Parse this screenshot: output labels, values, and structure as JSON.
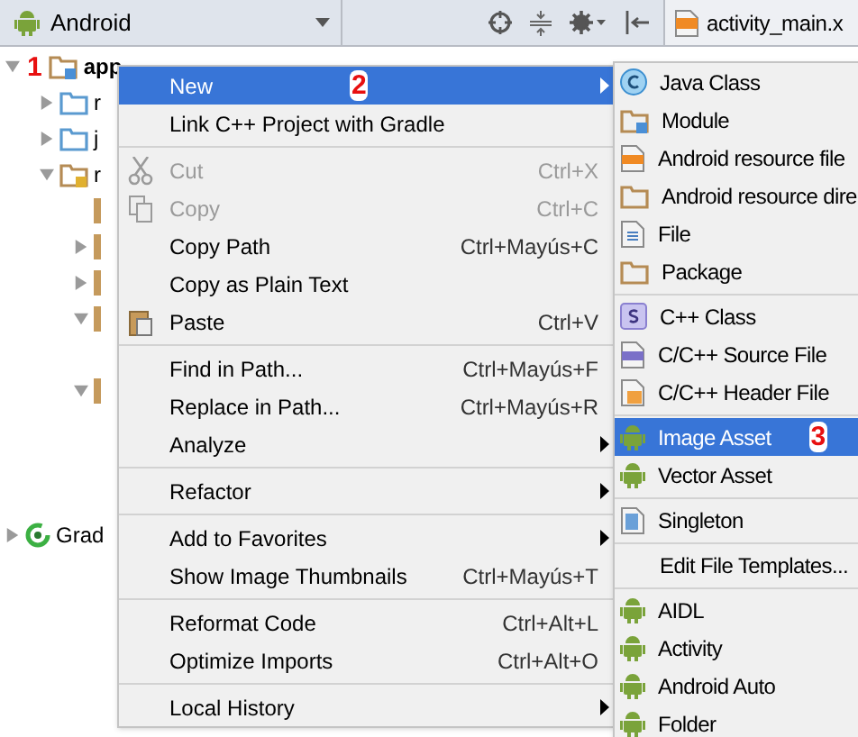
{
  "toolbar": {
    "view": "Android",
    "tab": "activity_main.x"
  },
  "tree": [
    {
      "label": "app",
      "expanded": true,
      "marker": "1",
      "children": [
        {
          "label": "r",
          "expanded": false
        },
        {
          "label": "j",
          "expanded": false
        },
        {
          "label": "r",
          "expanded": true,
          "children": [
            {
              "kind": "leaf"
            },
            {
              "kind": "node",
              "expanded": false
            },
            {
              "kind": "node",
              "expanded": false
            },
            {
              "kind": "node",
              "expanded": true
            },
            {
              "kind": "node",
              "expanded": true
            }
          ]
        }
      ]
    },
    {
      "label": "Grad",
      "expanded": false
    }
  ],
  "context_menu": [
    {
      "kind": "item",
      "label": "New",
      "submenu": true,
      "selected": true,
      "disabled": false,
      "marker": "2"
    },
    {
      "kind": "item",
      "label": "Link C++ Project with Gradle",
      "submenu": false,
      "selected": false,
      "disabled": false
    },
    {
      "kind": "separator"
    },
    {
      "kind": "item",
      "label": "Cut",
      "shortcut": "Ctrl+X",
      "submenu": false,
      "selected": false,
      "disabled": true
    },
    {
      "kind": "item",
      "label": "Copy",
      "shortcut": "Ctrl+C",
      "submenu": false,
      "selected": false,
      "disabled": true
    },
    {
      "kind": "item",
      "label": "Copy Path",
      "shortcut": "Ctrl+Mayús+C",
      "submenu": false,
      "selected": false,
      "disabled": false
    },
    {
      "kind": "item",
      "label": "Copy as Plain Text",
      "submenu": false,
      "selected": false,
      "disabled": false
    },
    {
      "kind": "item",
      "label": "Paste",
      "shortcut": "Ctrl+V",
      "submenu": false,
      "selected": false,
      "disabled": false
    },
    {
      "kind": "separator"
    },
    {
      "kind": "item",
      "label": "Find in Path...",
      "shortcut": "Ctrl+Mayús+F",
      "submenu": false,
      "selected": false,
      "disabled": false
    },
    {
      "kind": "item",
      "label": "Replace in Path...",
      "shortcut": "Ctrl+Mayús+R",
      "submenu": false,
      "selected": false,
      "disabled": false
    },
    {
      "kind": "item",
      "label": "Analyze",
      "submenu": true,
      "selected": false,
      "disabled": false
    },
    {
      "kind": "separator"
    },
    {
      "kind": "item",
      "label": "Refactor",
      "submenu": true,
      "selected": false,
      "disabled": false
    },
    {
      "kind": "separator"
    },
    {
      "kind": "item",
      "label": "Add to Favorites",
      "submenu": true,
      "selected": false,
      "disabled": false
    },
    {
      "kind": "item",
      "label": "Show Image Thumbnails",
      "shortcut": "Ctrl+Mayús+T",
      "submenu": false,
      "selected": false,
      "disabled": false
    },
    {
      "kind": "separator"
    },
    {
      "kind": "item",
      "label": "Reformat Code",
      "shortcut": "Ctrl+Alt+L",
      "submenu": false,
      "selected": false,
      "disabled": false
    },
    {
      "kind": "item",
      "label": "Optimize Imports",
      "shortcut": "Ctrl+Alt+O",
      "submenu": false,
      "selected": false,
      "disabled": false
    },
    {
      "kind": "separator"
    },
    {
      "kind": "item",
      "label": "Local History",
      "submenu": true,
      "selected": false,
      "disabled": false
    }
  ],
  "new_submenu": [
    {
      "kind": "item",
      "label": "Java Class",
      "selected": false
    },
    {
      "kind": "item",
      "label": "Module",
      "selected": false
    },
    {
      "kind": "item",
      "label": "Android resource file",
      "selected": false
    },
    {
      "kind": "item",
      "label": "Android resource dire",
      "selected": false
    },
    {
      "kind": "item",
      "label": "File",
      "selected": false
    },
    {
      "kind": "item",
      "label": "Package",
      "selected": false
    },
    {
      "kind": "separator"
    },
    {
      "kind": "item",
      "label": "C++ Class",
      "selected": false
    },
    {
      "kind": "item",
      "label": "C/C++ Source File",
      "selected": false
    },
    {
      "kind": "item",
      "label": "C/C++ Header File",
      "selected": false
    },
    {
      "kind": "separator"
    },
    {
      "kind": "item",
      "label": "Image Asset",
      "selected": true,
      "marker": "3"
    },
    {
      "kind": "item",
      "label": "Vector Asset",
      "selected": false
    },
    {
      "kind": "separator"
    },
    {
      "kind": "item",
      "label": "Singleton",
      "selected": false
    },
    {
      "kind": "separator"
    },
    {
      "kind": "item",
      "label": "Edit File Templates...",
      "selected": false
    },
    {
      "kind": "separator"
    },
    {
      "kind": "item",
      "label": "AIDL",
      "selected": false
    },
    {
      "kind": "item",
      "label": "Activity",
      "selected": false
    },
    {
      "kind": "item",
      "label": "Android Auto",
      "selected": false
    },
    {
      "kind": "item",
      "label": "Folder",
      "selected": false
    }
  ]
}
